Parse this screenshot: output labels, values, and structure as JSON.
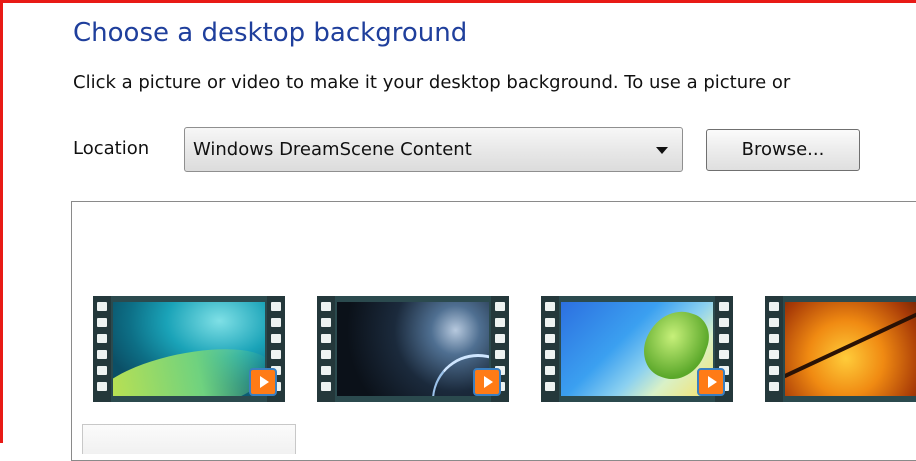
{
  "page": {
    "title": "Choose a desktop background",
    "description": "Click a picture or video to make it your desktop background. To use a picture or"
  },
  "location": {
    "label": "Location",
    "selected": "Windows DreamScene Content",
    "browse_label": "Browse..."
  },
  "gallery": {
    "items": [
      {
        "name": "teal-swirl-video"
      },
      {
        "name": "dark-space-video"
      },
      {
        "name": "green-leaf-video"
      },
      {
        "name": "autumn-leaves-video"
      }
    ]
  },
  "colors": {
    "title": "#1f3f9c",
    "frame_border": "#e81a16",
    "play_badge": "#ff7b16"
  }
}
